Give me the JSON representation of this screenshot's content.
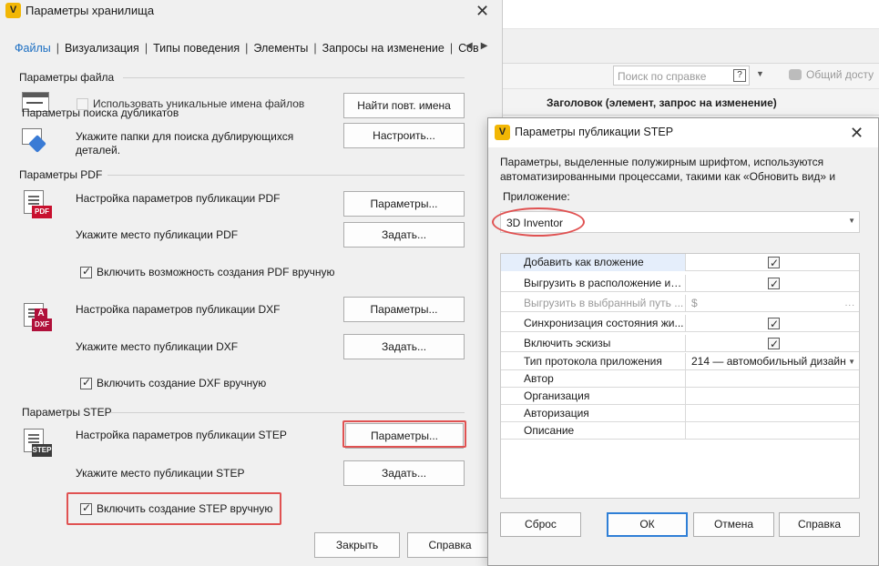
{
  "background_app": {
    "search_placeholder": "Поиск по справке",
    "shared_label": "Общий досту",
    "grid_header": "Заголовок (элемент, запрос на изменение)"
  },
  "vault_dialog": {
    "icon_letter": "V",
    "title": "Параметры хранилища",
    "tabs": [
      "Файлы",
      "Визуализация",
      "Типы поведения",
      "Элементы",
      "Запросы на изменение",
      "Сов"
    ],
    "file_section": {
      "title": "Параметры файла",
      "unique_names_label": "Использовать уникальные имена файлов",
      "unique_names_checked": false,
      "find_duplicates_button": "Найти повт. имена",
      "duplicate_search_title": "Параметры поиска дубликатов",
      "duplicate_folders_label": "Укажите папки для поиска дублирующихся деталей.",
      "configure_button": "Настроить..."
    },
    "pdf_section": {
      "title": "Параметры PDF",
      "icon_tag": "PDF",
      "publish_label": "Настройка параметров публикации PDF",
      "params_button": "Параметры...",
      "location_label": "Укажите место публикации PDF",
      "set_button": "Задать...",
      "manual_label": "Включить возможность создания PDF вручную",
      "manual_checked": true
    },
    "dxf_section": {
      "icon_tag": "DXF",
      "publish_label": "Настройка параметров публикации DXF",
      "params_button": "Параметры...",
      "location_label": "Укажите место публикации DXF",
      "set_button": "Задать...",
      "manual_label": "Включить создание DXF вручную",
      "manual_checked": true
    },
    "step_section": {
      "title": "Параметры STEP",
      "icon_tag": "STEP",
      "publish_label": "Настройка параметров публикации STEP",
      "params_button": "Параметры...",
      "location_label": "Укажите место публикации STEP",
      "set_button": "Задать...",
      "manual_label": "Включить создание STEP вручную",
      "manual_checked": true
    },
    "close_button": "Закрыть",
    "help_button": "Справка"
  },
  "step_dialog": {
    "icon_letter": "V",
    "title": "Параметры публикации STEP",
    "description": "Параметры, выделенные полужирным шрифтом, используются автоматизированными процессами, такими как «Обновить вид» и",
    "application_label": "Приложение:",
    "application_value": "3D Inventor",
    "properties": [
      {
        "name": "Добавить как вложение",
        "type": "check",
        "checked": true,
        "selected": true
      },
      {
        "name": "Выгрузить в расположение ис...",
        "type": "check",
        "checked": true
      },
      {
        "name": "Выгрузить в выбранный путь ...",
        "type": "path",
        "value": "$",
        "disabled": true
      },
      {
        "name": "Синхронизация состояния жи...",
        "type": "check",
        "checked": true
      },
      {
        "name": "Включить эскизы",
        "type": "check",
        "checked": true
      },
      {
        "name": "Тип протокола приложения",
        "type": "select",
        "value": "214 — автомобильный дизайн"
      },
      {
        "name": "Автор",
        "type": "text",
        "value": ""
      },
      {
        "name": "Организация",
        "type": "text",
        "value": ""
      },
      {
        "name": "Авторизация",
        "type": "text",
        "value": ""
      },
      {
        "name": "Описание",
        "type": "text",
        "value": ""
      }
    ],
    "buttons": {
      "reset": "Сброс",
      "ok": "ОК",
      "cancel": "Отмена",
      "help": "Справка"
    }
  },
  "colors": {
    "active_tab": "#1b6ec2",
    "highlight": "#e05252",
    "app_icon": "#f2b705",
    "pdf_tag": "#c8102e",
    "dxf_tag": "#b0103a",
    "step_tag": "#3c3c3c",
    "default_button_border": "#2f7fd6"
  }
}
